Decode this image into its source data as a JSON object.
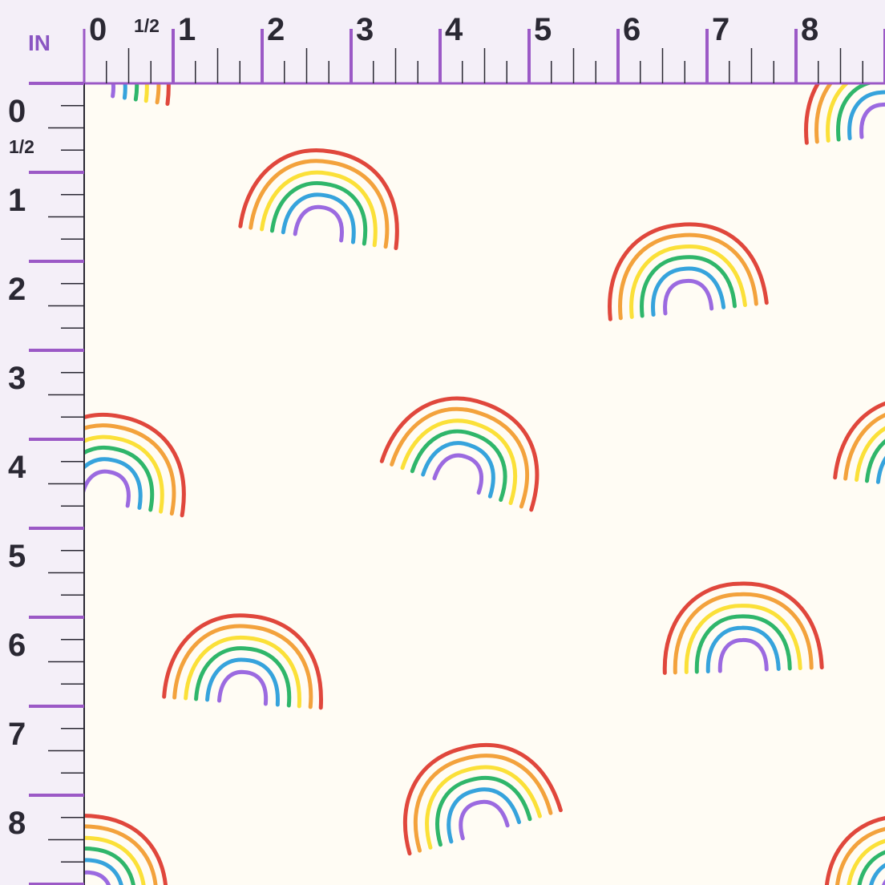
{
  "ruler": {
    "unit_label": "IN",
    "half_label": "1/2",
    "top_labels": [
      "0",
      "1",
      "2",
      "3",
      "4",
      "5",
      "6",
      "7",
      "8"
    ],
    "left_labels": [
      "0",
      "1",
      "2",
      "3",
      "4",
      "5",
      "6",
      "7",
      "8"
    ],
    "accent_color": "#9b59c6",
    "tick_color": "#2a2833",
    "chrome_color": "#f4eff8"
  },
  "fabric": {
    "background_color": "#fffcf4",
    "motif": "rainbow-icon",
    "motif_count": 14,
    "rainbow_colors": [
      "#e0473c",
      "#f3a23c",
      "#fbe038",
      "#2fb66a",
      "#36a3dc",
      "#9b6ae0"
    ]
  }
}
